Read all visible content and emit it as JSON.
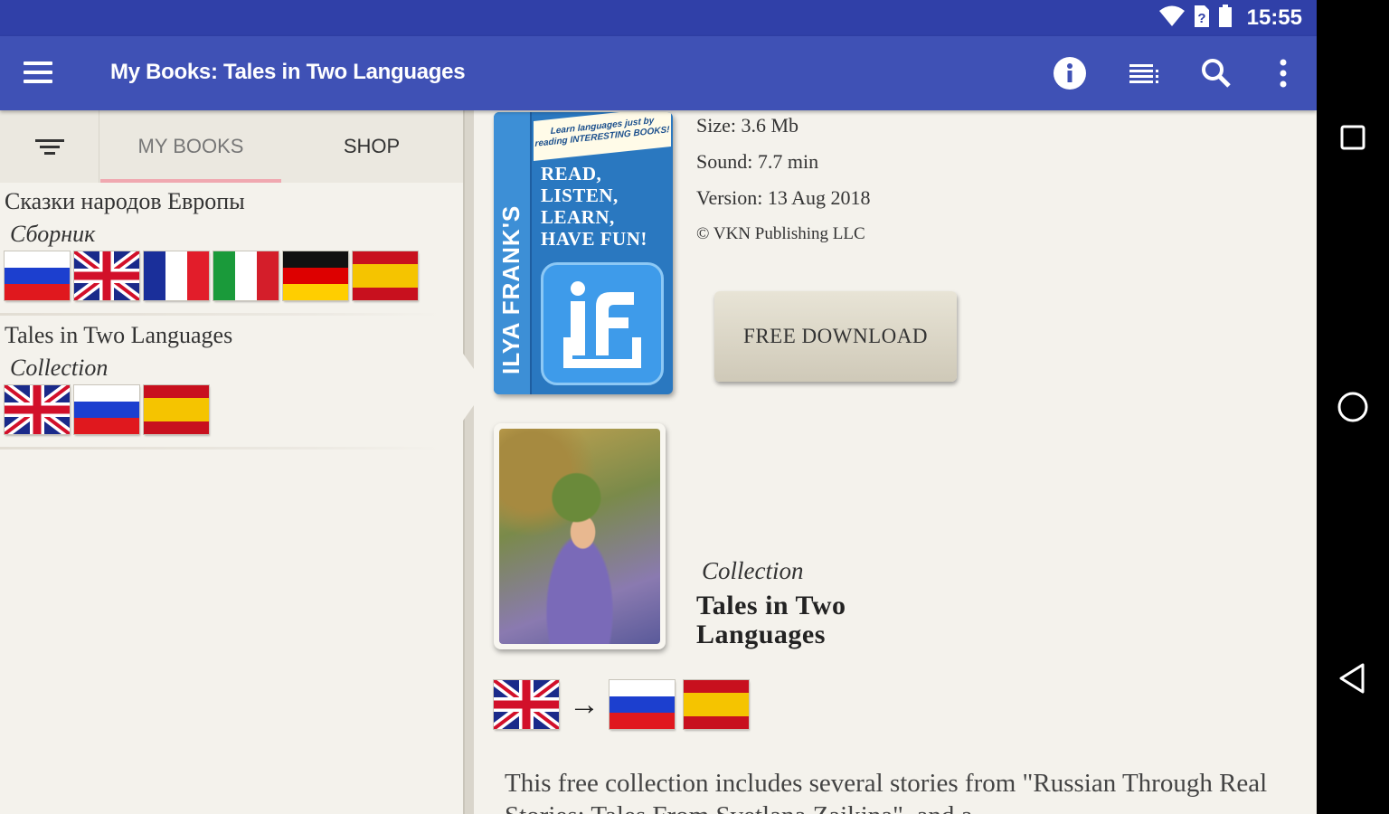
{
  "status_bar": {
    "time": "15:55",
    "icons": [
      "wifi-icon",
      "sim-unknown-icon",
      "battery-icon"
    ]
  },
  "app_bar": {
    "title": "My Books: Tales in Two Languages",
    "icons": [
      "menu-icon",
      "info-icon",
      "list-view-icon",
      "search-icon",
      "more-vert-icon"
    ]
  },
  "left_panel": {
    "tabs": [
      {
        "label": "MY BOOKS",
        "selected": true
      },
      {
        "label": "SHOP",
        "selected": false
      }
    ],
    "library": [
      {
        "title": "Сказки народов Европы",
        "subtitle": "Сборник",
        "flags": [
          "ru",
          "gb",
          "fr",
          "it",
          "de",
          "es"
        ]
      },
      {
        "title": "Tales in Two Languages",
        "subtitle": "Collection",
        "flags": [
          "gb",
          "ru",
          "es"
        ]
      }
    ]
  },
  "right_panel": {
    "book_cover": {
      "spine_text": "ILYA FRANK'S",
      "banner_text": "Learn languages just by reading INTERESTING BOOKS!",
      "cover_lines": [
        "READ,",
        "LISTEN,",
        "LEARN,",
        "HAVE FUN!"
      ]
    },
    "meta": {
      "size": "Size: 3.6 Mb",
      "sound": "Sound: 7.7 min",
      "version": "Version: 13 Aug 2018",
      "copyright": "© VKN Publishing LLC"
    },
    "download_label": "FREE DOWNLOAD",
    "collection": {
      "subtitle": "Collection",
      "title": "Tales in Two Languages",
      "source_flag": "gb",
      "arrow": "→",
      "target_flags": [
        "ru",
        "es"
      ]
    },
    "description": "This free collection includes several stories from \"Russian Through Real Stories: Tales From Svetlana Zaikina\", and a"
  },
  "colors": {
    "status_bar": "#3040a8",
    "app_bar": "#3f51b5",
    "panel_bg": "#f4f2ec",
    "tab_indicator": "#f0a8b0"
  }
}
